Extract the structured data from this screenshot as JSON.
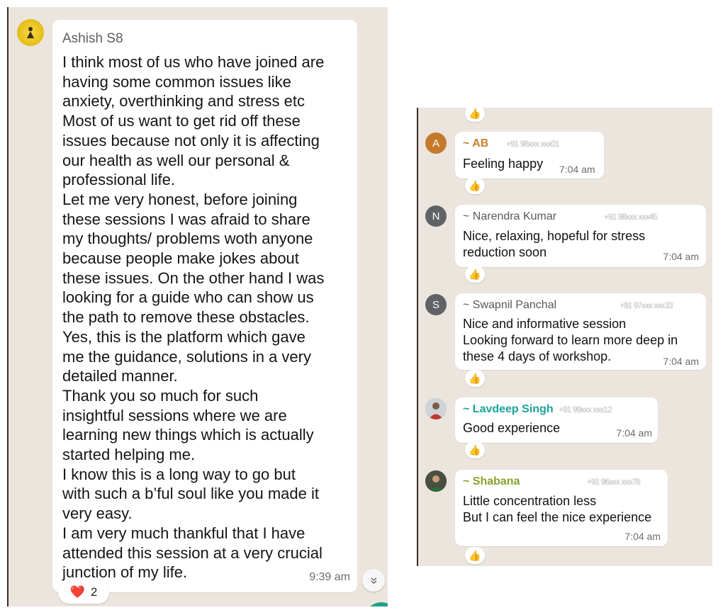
{
  "left_chat": {
    "sender": "Ashish S8",
    "message": "I think most of us who have joined are\nhaving some common issues like\nanxiety, overthinking and stress etc\nMost of us want to get rid off these\nissues because not only it is affecting\nour health as well our personal &\nprofessional life.\nLet me very honest, before joining\nthese sessions I was afraid to share\nmy thoughts/ problems woth anyone\nbecause people make jokes about\nthese issues. On the other hand I was\nlooking for a guide who can show us\nthe path to remove these obstacles.\nYes, this is the platform which gave\nme the guidance, solutions in a very\ndetailed manner.\nThank you so much for such\ninsightful sessions where we are\nlearning new things which is actually\nstarted helping me.\nI know this is a long way to go but\nwith such a b’ful soul like you made it\nvery easy.\nI am very much thankful that I have\nattended this session at a very crucial\njunction of my life.",
    "time": "9:39 am",
    "reaction": {
      "emoji": "❤️",
      "count": "2"
    },
    "scroll_icon": "«"
  },
  "right_chat": {
    "top_reaction": "👍",
    "messages": [
      {
        "sender": "~ AB",
        "phone": "+91 98xxx xxx01",
        "text": "Feeling happy",
        "time": "7:04 am",
        "avatar_letter": "A",
        "avatar_color": "#c47a2c",
        "reaction": "👍"
      },
      {
        "sender": "~ Narendra Kumar",
        "phone": "+91 98xxx xxx45",
        "text": "Nice, relaxing, hopeful for stress\nreduction soon",
        "time": "7:04 am",
        "avatar_letter": "N",
        "avatar_color": "#5f6266",
        "reaction": "👍"
      },
      {
        "sender": "~ Swapnil Panchal",
        "phone": "+91 97xxx xxx33",
        "text": "Nice and informative session\nLooking forward to learn more deep in\nthese 4 days of workshop.",
        "time": "7:04 am",
        "avatar_letter": "S",
        "avatar_color": "#5f6266",
        "reaction": "👍"
      },
      {
        "sender": "~ Lavdeep Singh",
        "phone": "+91 99xxx xxx12",
        "text": "Good experience",
        "time": "7:04 am",
        "avatar_letter": "",
        "avatar_color": "#8d8d8d",
        "reaction": "👍"
      },
      {
        "sender": "~ Shabana",
        "phone": "+91 96xxx xxx78",
        "text": "Little concentration less\nBut I can feel the nice experience",
        "time": "7:04 am",
        "avatar_letter": "",
        "avatar_color": "#3f3f3f",
        "reaction": "👍"
      }
    ]
  },
  "colors": {
    "chat_bg": "#ece5dd",
    "ab_name": "#c9822e",
    "lavdeep_name": "#1aa39a",
    "shabana_name": "#87a12a"
  }
}
